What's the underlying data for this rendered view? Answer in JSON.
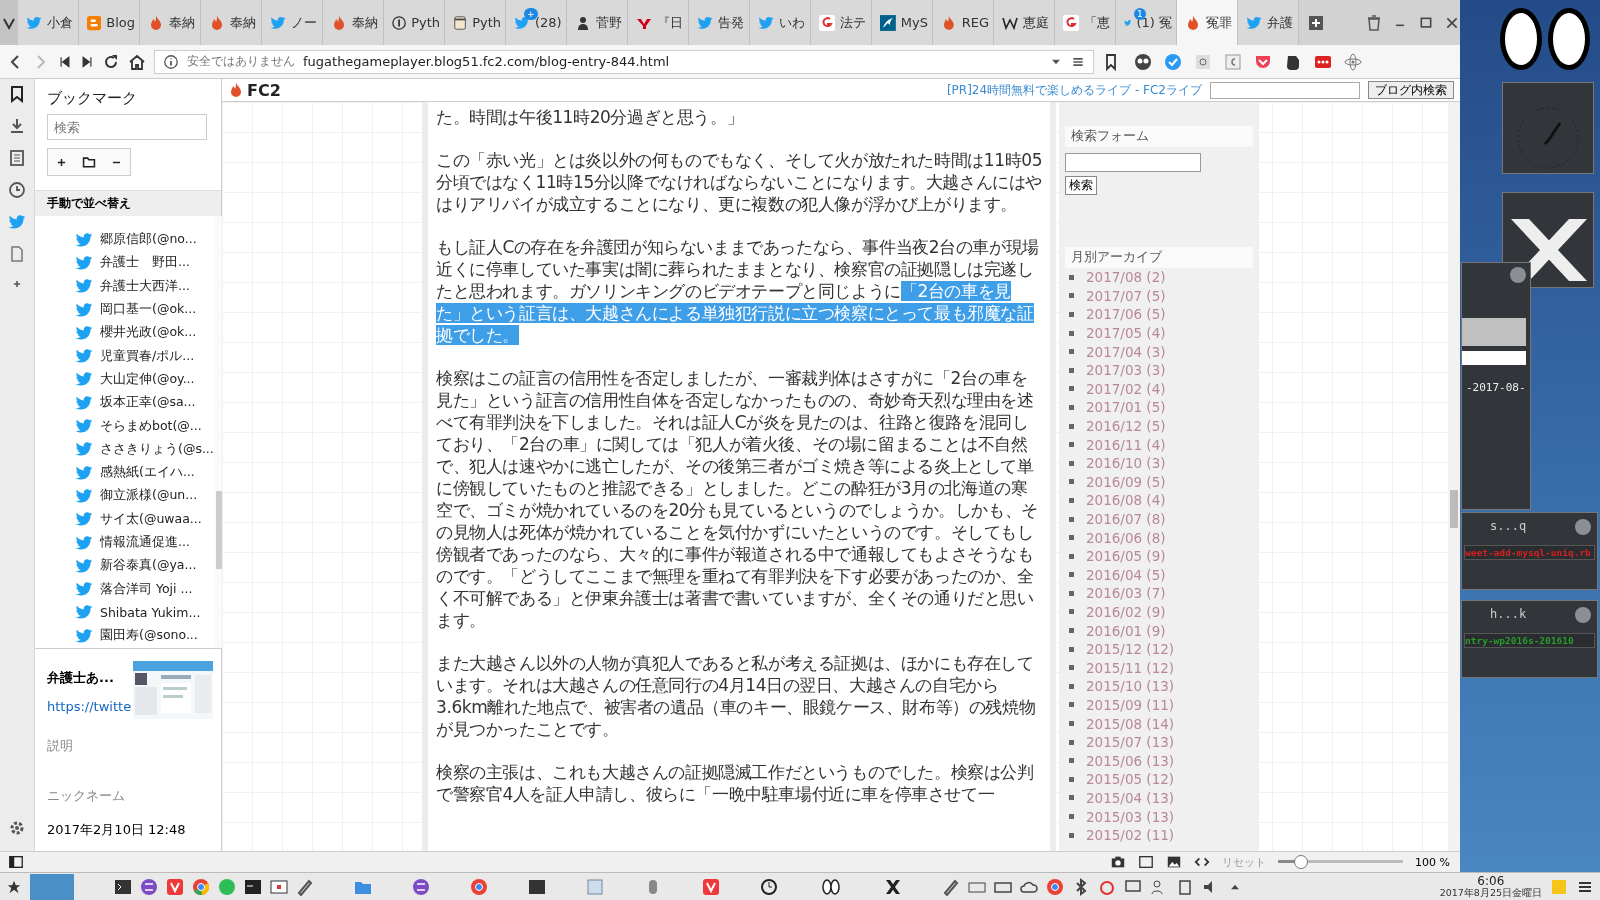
{
  "browser": {
    "tabs": [
      {
        "label": "小倉",
        "kind": "twitter",
        "selected": false
      },
      {
        "label": "Blog",
        "kind": "blogger",
        "selected": false
      },
      {
        "label": "奉納",
        "kind": "fc2",
        "selected": false
      },
      {
        "label": "奉納",
        "kind": "fc2",
        "selected": false
      },
      {
        "label": "ノー",
        "kind": "twitter",
        "selected": false
      },
      {
        "label": "奉納",
        "kind": "fc2",
        "selected": false
      },
      {
        "label": "Pyth",
        "kind": "info",
        "selected": false
      },
      {
        "label": "Pyth",
        "kind": "face",
        "selected": false
      },
      {
        "label": "(28)",
        "kind": "twitter",
        "badge": "+",
        "selected": false
      },
      {
        "label": "菅野",
        "kind": "person",
        "selected": false
      },
      {
        "label": "『日",
        "kind": "yahoo",
        "selected": false
      },
      {
        "label": "告発",
        "kind": "twitter",
        "selected": false
      },
      {
        "label": "いわ",
        "kind": "twitter",
        "selected": false
      },
      {
        "label": "法テ",
        "kind": "g",
        "selected": false
      },
      {
        "label": "MyS",
        "kind": "dolphin",
        "selected": false
      },
      {
        "label": "REG",
        "kind": "fc2",
        "selected": false
      },
      {
        "label": "恵庭",
        "kind": "wiki",
        "selected": false
      },
      {
        "label": "「恵",
        "kind": "g",
        "selected": false
      },
      {
        "label": "(1) 冤",
        "kind": "twitter",
        "badge": "1",
        "selected": false
      },
      {
        "label": "冤罪",
        "kind": "fc2",
        "selected": true
      },
      {
        "label": "弁護",
        "kind": "twitter",
        "selected": false
      }
    ],
    "security": "安全ではありません",
    "url": "fugathegameplayer.blog51.fc2.com/blog-entry-844.html"
  },
  "panel": {
    "title": "ブックマーク",
    "search_placeholder": "検索",
    "sort_label": "手動で並べ替え",
    "bookmarks": [
      "郷原信郎(@no...",
      "弁護士　野田...",
      "弁護士大西洋...",
      "岡口基一(@ok...",
      "櫻井光政(@ok...",
      "児童買春/ポル...",
      "大山定伸(@oy...",
      "坂本正幸(@sa...",
      "そらまめbot(@...",
      "ささきりょう(@s...",
      "感熱紙(エイハ...",
      "御立派様(@un...",
      "サイ太(@uwaa...",
      "情報流通促進...",
      "新谷泰真(@ya...",
      "落合洋司 Yoji ...",
      "Shibata Yukim...",
      "園田寿(@sono..."
    ],
    "detail": {
      "name": "弁護士あ...",
      "link": "https://twitte",
      "description_label": "説明",
      "nickname_label": "ニックネーム",
      "date": "2017年2月10日 12:48"
    }
  },
  "blog_header": {
    "logo": "FC2",
    "ad": "[PR]24時間無料で楽しめるライブ - FC2ライブ",
    "search_button": "ブログ内検索"
  },
  "article": {
    "paragraphs": [
      [
        {
          "text": "た。時間は午後11時20分過ぎと思う。」",
          "selected": false
        }
      ],
      [
        {
          "text": "この「赤い光」とは炎以外の何ものでもなく、そして火が放たれた時間は11時05分頃ではなく11時15分以降でなければならないことになります。大越さんにはやはりアリバイが成立することになり、更に複数の犯人像が浮かび上がります。",
          "selected": false
        }
      ],
      [
        {
          "text": "もし証人Cの存在を弁護団が知らないままであったなら、事件当夜2台の車が現場近くに停車していた事実は闇に葬られたままとなり、検察官の証拠隠しは完遂したと思われます。ガソリンキングのビデオテープと同じように",
          "selected": false
        },
        {
          "text": "「2台の車を見た」という証言は、大越さんによる単独犯行説に立つ検察にとって最も邪魔な証拠でした。",
          "selected": true
        }
      ],
      [
        {
          "text": "検察はこの証言の信用性を否定しましたが、一審裁判体はさすがに「2台の車を見た」という証言の信用性自体を否定しなかったものの、奇妙奇天烈な理由を述べて有罪判決を下しました。それは証人Cが炎を見たのは、往路と復路を混同しており、「2台の車」に関しては「犯人が着火後、その場に留まることは不自然で、犯人は速やかに逃亡したが、その後第三者がゴミ焼き等による炎上として単に傍観していたものと推認できる」としました。どこの酔狂が3月の北海道の寒空で、ゴミが焼かれているのを20分も見ているというのでしょうか。しかも、その見物人は死体が焼かれていることを気付かずにいたというのです。そしてもし傍観者であったのなら、大々的に事件が報道される中で通報してもよさそうなものです。「どうしてここまで無理を重ねて有罪判決を下す必要があったのか、全く不可解である」と伊東弁護士は著書で書いていますが、全くその通りだと思います。",
          "selected": false
        }
      ],
      [
        {
          "text": "また大越さん以外の人物が真犯人であると私が考える証拠は、ほかにも存在しています。それは大越さんの任意同行の4月14日の翌日、大越さんの自宅から3.6km離れた地点で、被害者の遺品（車のキー、眼鏡ケース、財布等）の残焼物が見つかったことです。",
          "selected": false
        }
      ],
      [
        {
          "text": "検察の主張は、これも大越さんの証拠隠滅工作だというものでした。検察は公判で警察官4人を証人申請し、彼らに「一晩中駐車場付近に車を停車させて一",
          "selected": false
        }
      ]
    ]
  },
  "blog_sidebar": {
    "search_title": "検索フォーム",
    "search_button": "検索",
    "archive_title": "月別アーカイブ",
    "archives": [
      "2017/08 (2)",
      "2017/07 (5)",
      "2017/06 (5)",
      "2017/05 (4)",
      "2017/04 (3)",
      "2017/03 (3)",
      "2017/02 (4)",
      "2017/01 (5)",
      "2016/12 (5)",
      "2016/11 (4)",
      "2016/10 (3)",
      "2016/09 (5)",
      "2016/08 (4)",
      "2016/07 (8)",
      "2016/06 (8)",
      "2016/05 (9)",
      "2016/04 (5)",
      "2016/03 (7)",
      "2016/02 (9)",
      "2016/01 (9)",
      "2015/12 (12)",
      "2015/11 (12)",
      "2015/10 (13)",
      "2015/09 (11)",
      "2015/08 (14)",
      "2015/07 (13)",
      "2015/06 (13)",
      "2015/05 (12)",
      "2015/04 (13)",
      "2015/03 (13)",
      "2015/02 (11)"
    ]
  },
  "status_bar": {
    "reset": "リセット",
    "zoom": {
      "level": 0.18,
      "reading": "100 %"
    }
  },
  "desktop": {
    "terminal_text": "-2017-08-",
    "windows": [
      {
        "title": "s...q",
        "line": "weet-add-mysql-uniq.rb",
        "color": "#d42020"
      },
      {
        "title": "h...k",
        "line": "ntry-wp2016s-201610",
        "color": "#2a9a2a"
      }
    ]
  },
  "taskbar": {
    "time": "6:06",
    "date": "2017年8月25日金曜日"
  }
}
